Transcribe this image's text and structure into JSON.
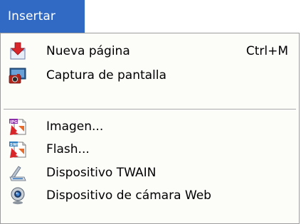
{
  "menubar": {
    "active_menu": "Insertar",
    "accent_color": "#316ac5"
  },
  "menu": {
    "items": [
      {
        "label": "Nueva página",
        "shortcut": "Ctrl+M",
        "icon": "new-page-icon"
      },
      {
        "label": "Captura de pantalla",
        "icon": "screenshot-camera-icon"
      },
      {
        "label": "Imagen...",
        "icon": "image-file-icon"
      },
      {
        "label": "Flash...",
        "icon": "flash-file-icon"
      },
      {
        "label": "Dispositivo TWAIN",
        "icon": "scanner-icon"
      },
      {
        "label": "Dispositivo de cámara Web",
        "icon": "webcam-icon"
      }
    ]
  }
}
